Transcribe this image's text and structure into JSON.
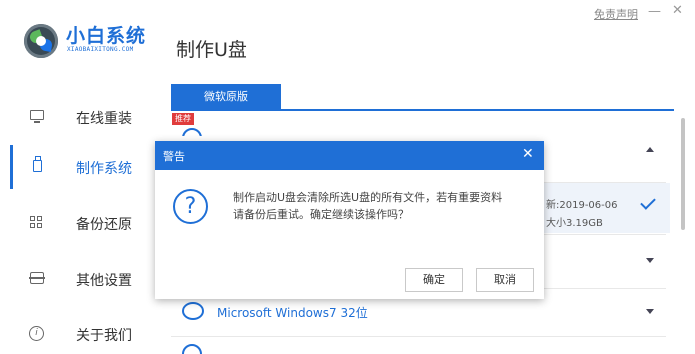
{
  "brand": {
    "name": "小白系统",
    "sub": "XIAOBAIXITONG.COM"
  },
  "page_title": "制作U盘",
  "window": {
    "disclaimer": "免责声明",
    "minimize": "—",
    "close": "✕"
  },
  "sidebar": {
    "items": [
      {
        "label": "在线重装",
        "icon": "monitor-icon"
      },
      {
        "label": "制作系统",
        "icon": "usb-icon"
      },
      {
        "label": "备份还原",
        "icon": "grid-icon"
      },
      {
        "label": "其他设置",
        "icon": "box-icon"
      },
      {
        "label": "关于我们",
        "icon": "info-icon"
      }
    ],
    "active_index": 1
  },
  "tab": {
    "label": "微软原版"
  },
  "badge": "推荐",
  "os_list": {
    "selected": {
      "update": "新:2019-06-06",
      "size": "大小3.19GB"
    },
    "items": [
      {
        "label": "Microsoft Windows7 32位"
      }
    ]
  },
  "dialog": {
    "title": "警告",
    "close": "✕",
    "icon": "?",
    "message_line1": "制作启动U盘会清除所选U盘的所有文件，若有重要资料",
    "message_line2": "请备份后重试。确定继续该操作吗？",
    "confirm": "确定",
    "cancel": "取消"
  },
  "colors": {
    "accent": "#1f6fd6",
    "badge": "#e03c3c"
  }
}
